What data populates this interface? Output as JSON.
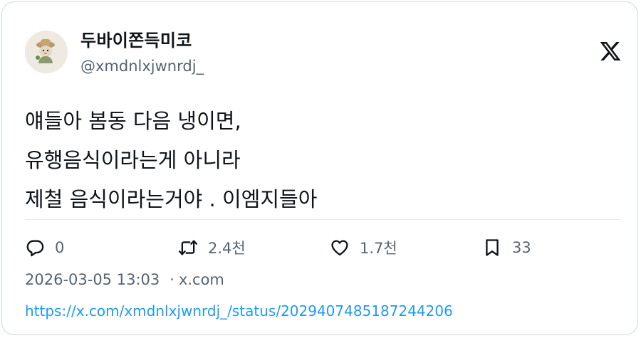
{
  "author": {
    "display_name": "두바이쫀득미코",
    "handle": "@xmdnlxjwnrdj_"
  },
  "tweet": {
    "lines": [
      "얘들아 봄동 다음 냉이면,",
      "유행음식이라는게 아니라",
      "제철 음식이라는거야 . 이엠지들아"
    ]
  },
  "actions": {
    "reply_count": "0",
    "retweet_count": "2.4천",
    "like_count": "1.7천",
    "bookmark_count": "33"
  },
  "meta": {
    "timestamp": "2026-03-05 13:03",
    "separator": "·",
    "source": "x.com"
  },
  "link": {
    "url": "https://x.com/xmdnlxjwnrdj_/status/2029407485187244206"
  },
  "icons": [
    "x-logo-icon",
    "reply-icon",
    "retweet-icon",
    "like-icon",
    "bookmark-icon"
  ],
  "colors": {
    "text": "#0f1419",
    "muted": "#536471",
    "link": "#1d9bf0",
    "border": "#cfd9de"
  }
}
